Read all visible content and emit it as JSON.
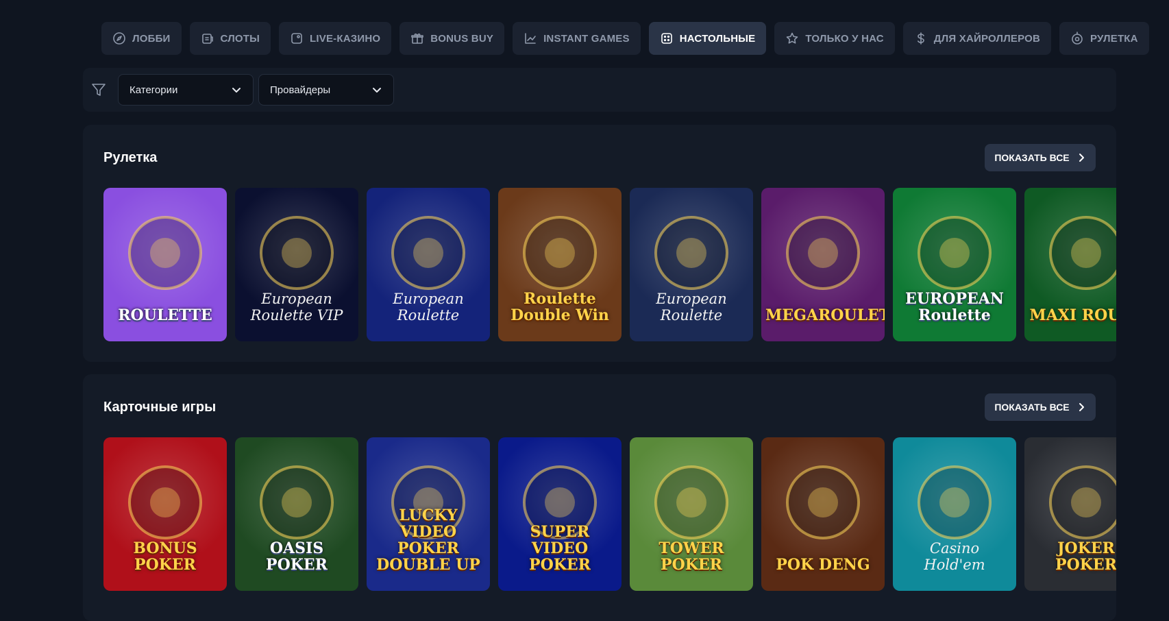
{
  "nav": {
    "tabs": [
      {
        "label": "ЛОББИ",
        "icon": "compass-icon",
        "active": false
      },
      {
        "label": "СЛОТЫ",
        "icon": "slot-icon",
        "active": false
      },
      {
        "label": "LIVE-КАЗИНО",
        "icon": "live-icon",
        "active": false
      },
      {
        "label": "BONUS BUY",
        "icon": "gift-icon",
        "active": false
      },
      {
        "label": "INSTANT GAMES",
        "icon": "chart-icon",
        "active": false
      },
      {
        "label": "НАСТОЛЬНЫЕ",
        "icon": "dice-icon",
        "active": true
      },
      {
        "label": "ТОЛЬКО У НАС",
        "icon": "star-icon",
        "active": false
      },
      {
        "label": "ДЛЯ ХАЙРОЛЛЕРОВ",
        "icon": "dollar-icon",
        "active": false
      },
      {
        "label": "РУЛЕТКА",
        "icon": "roulette-icon",
        "active": false
      }
    ]
  },
  "filters": {
    "categories_label": "Категории",
    "providers_label": "Провайдеры"
  },
  "sections": {
    "roulette": {
      "title": "Рулетка",
      "show_all": "ПОКАЗАТЬ ВСЕ",
      "games": [
        {
          "label": "ROULETTE",
          "style": "white",
          "bg": "#8a4fe0"
        },
        {
          "label": "European Roulette VIP",
          "style": "italic",
          "bg": "#0b1030"
        },
        {
          "label": "European Roulette",
          "style": "italic",
          "bg": "#14237a"
        },
        {
          "label": "Roulette Double Win",
          "style": "gold",
          "bg": "#6b3a1a"
        },
        {
          "label": "European Roulette",
          "style": "italic",
          "bg": "#1b2a55"
        },
        {
          "label": "MEGAROULETTE",
          "style": "gold",
          "bg": "#5a1c6a"
        },
        {
          "label": "EUROPEAN Roulette",
          "style": "white",
          "bg": "#0f7a34"
        },
        {
          "label": "MAXI ROULE",
          "style": "gold",
          "bg": "#0f5a24"
        }
      ]
    },
    "cards": {
      "title": "Карточные игры",
      "show_all": "ПОКАЗАТЬ ВСЕ",
      "games": [
        {
          "label": "BONUS POKER",
          "style": "gold",
          "bg": "#b0101a"
        },
        {
          "label": "OASIS POKER",
          "style": "white",
          "bg": "#1f4a22"
        },
        {
          "label": "LUCKY VIDEO POKER DOUBLE UP",
          "style": "gold",
          "bg": "#1a2a8a"
        },
        {
          "label": "SUPER VIDEO POKER",
          "style": "gold",
          "bg": "#0a1a8a"
        },
        {
          "label": "TOWER POKER",
          "style": "gold",
          "bg": "#5a8a3a"
        },
        {
          "label": "POK DENG",
          "style": "gold",
          "bg": "#5a2a14"
        },
        {
          "label": "Casino Hold'em",
          "style": "italic",
          "bg": "#0f8a9a"
        },
        {
          "label": "JOKER POKER",
          "style": "gold",
          "bg": "#2a2d33"
        }
      ]
    }
  }
}
